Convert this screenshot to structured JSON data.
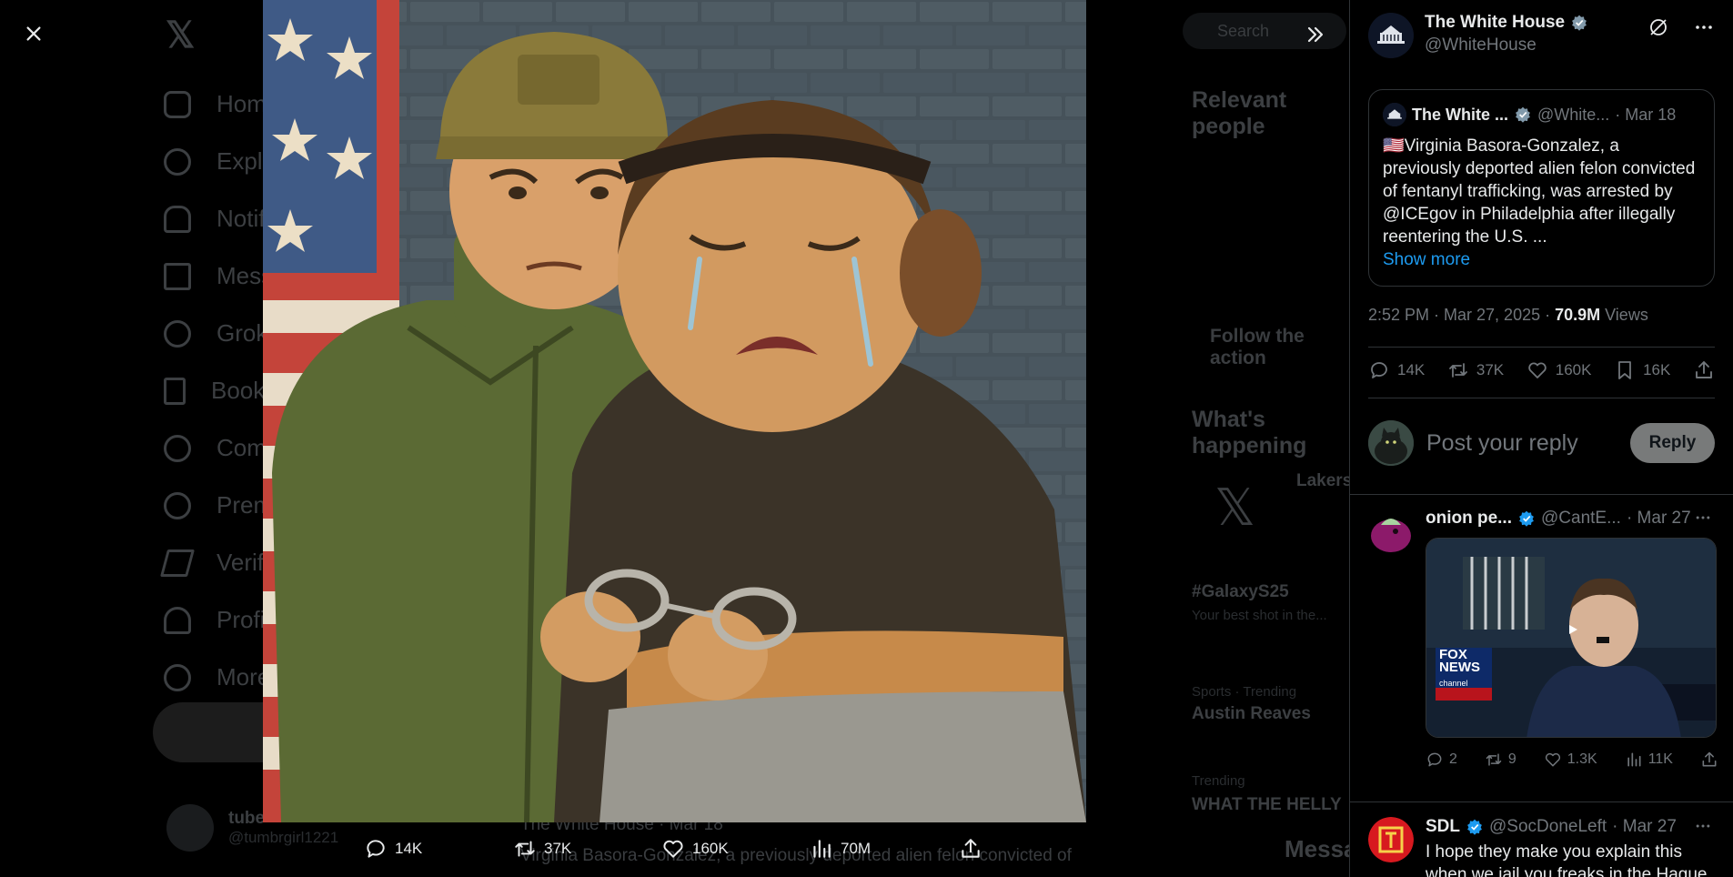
{
  "background": {
    "nav_items": [
      "Home",
      "Explore",
      "Notifications",
      "Messages",
      "Grok",
      "Bookmarks",
      "Communities",
      "Premium",
      "Verified Orgs",
      "Profile",
      "More"
    ],
    "search_placeholder": "Search",
    "relevant_people_heading": "Relevant people",
    "whats_happening_heading": "What's happening",
    "follow_text": "Follow the action",
    "user_name": "tube",
    "user_handle": "@tumbrgirl1221",
    "trend_1_title": "#GalaxyS25",
    "trend_1_sub": "Your best shot in the...",
    "trend_2_title": "Austin Reaves",
    "trend_2_sub": "Sports · Trending",
    "trend_3_title": "WHAT THE HELLY",
    "trend_3_sub": "Trending",
    "lakers": "Lakers",
    "messages": "Messages",
    "quoted_preview": "The White House · Mar 18",
    "bg_post_text": "Virginia Basora-Gonzalez, a previously deported alien felon convicted of"
  },
  "media": {
    "alt": "Cartoon of an officer in camouflage cap holding a handcuffed, crying woman in front of a brick wall and an American flag"
  },
  "media_actions": {
    "replies": "14K",
    "retweets": "37K",
    "likes": "160K",
    "views": "70M"
  },
  "panel": {
    "author_name": "The White House",
    "author_handle": "@WhiteHouse",
    "quote": {
      "name": "The White ...",
      "handle": "@White...",
      "date": "· Mar 18",
      "flag": "🇺🇸",
      "text": "Virginia Basora-Gonzalez, a previously deported alien felon convicted of fentanyl trafficking, was arrested by @ICEgov in Philadelphia after illegally reentering the U.S.",
      "ellipsis": "...",
      "show_more": "Show more"
    },
    "time": "2:52 PM · Mar 27, 2025 · ",
    "views_count": "70.9M",
    "views_label": " Views",
    "stats": {
      "replies": "14K",
      "retweets": "37K",
      "likes": "160K",
      "bookmarks": "16K"
    },
    "reply_placeholder": "Post your reply",
    "reply_button": "Reply",
    "replies": [
      {
        "name": "onion pe...",
        "handle": "@CantE...",
        "date": "· Mar 27",
        "stats": {
          "replies": "2",
          "retweets": "9",
          "likes": "1.3K",
          "views": "11K"
        },
        "thumb_logo_1": "FOX",
        "thumb_logo_2": "NEWS",
        "thumb_logo_3": "channel"
      },
      {
        "name": "SDL",
        "handle": "@SocDoneLeft",
        "date": "· Mar 27",
        "text": "I hope they make you explain this when we jail you freaks in the Hague"
      }
    ]
  },
  "colors": {
    "accent": "#1d9bf0",
    "secondary_text": "#71767b",
    "border": "#2f3336",
    "reply_button": "#787a7a"
  }
}
